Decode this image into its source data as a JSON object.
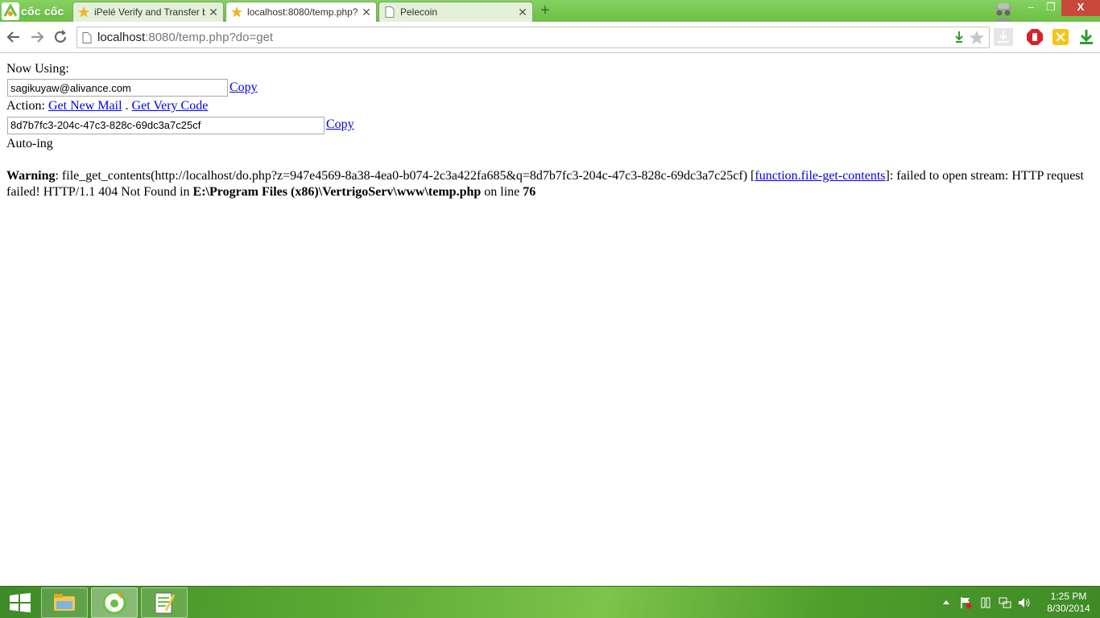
{
  "browser": {
    "brand_name": "cốc cốc",
    "tabs": [
      {
        "title": "iPelé Verify and Transfer b",
        "active": false
      },
      {
        "title": "localhost:8080/temp.php?",
        "active": true
      },
      {
        "title": "Pelecoin",
        "active": false
      }
    ],
    "window_controls": {
      "minimize": "–",
      "restore": "❐",
      "close": "X"
    }
  },
  "toolbar": {
    "address_host": "localhost",
    "address_rest": ":8080/temp.php?do=get"
  },
  "page": {
    "now_using_label": "Now Using:",
    "email_value": "sagikuyaw@alivance.com",
    "copy_label": "Copy",
    "action_label": "Action:",
    "get_new_mail_label": "Get New Mail",
    "separator": " . ",
    "get_very_code_label": "Get Very Code",
    "code_value": "8d7b7fc3-204c-47c3-828c-69dc3a7c25cf",
    "status_text": "Auto-ing",
    "warning": {
      "label": "Warning",
      "message_1": ": file_get_contents(http://localhost/do.php?z=947e4569-8a38-4ea0-b074-2c3a422fa685&q=8d7b7fc3-204c-47c3-828c-69dc3a7c25cf) [",
      "link": "function.file-get-contents",
      "message_2": "]: failed to open stream: HTTP request failed! HTTP/1.1 404 Not Found in ",
      "file": "E:\\Program Files (x86)\\VertrigoServ\\www\\temp.php",
      "message_3": " on line ",
      "line": "76"
    }
  },
  "taskbar": {
    "time": "1:25 PM",
    "date": "8/30/2014"
  },
  "colors": {
    "tabstrip": "#7bc955",
    "link": "#0000ee",
    "close_button": "#c9483b"
  }
}
